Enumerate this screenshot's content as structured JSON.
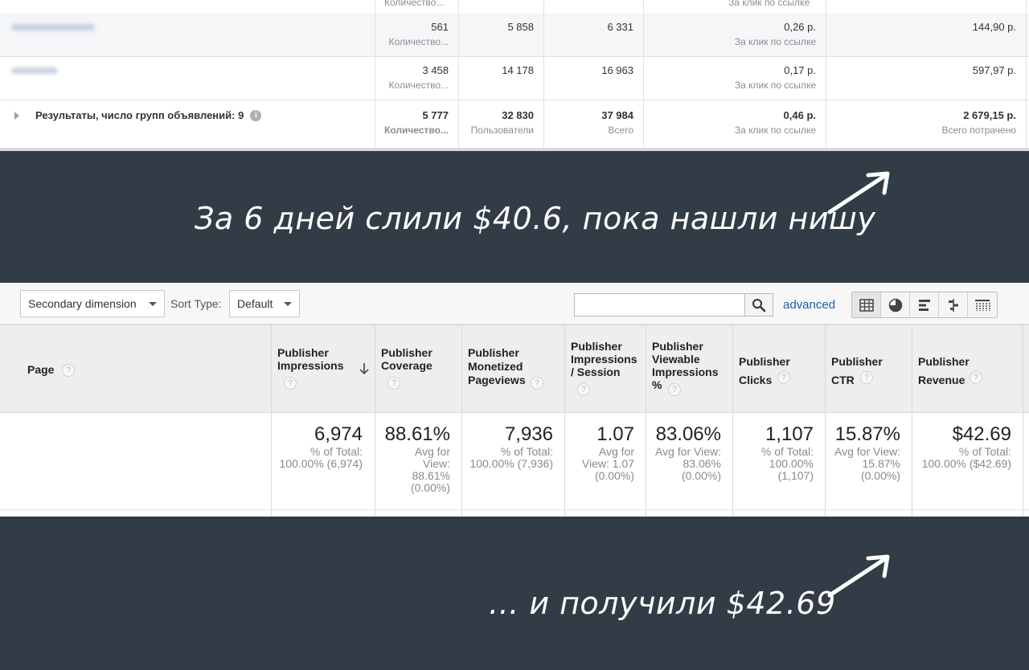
{
  "fb_table": {
    "top_row": {
      "sub": "Количество...",
      "sub_cpc": "За клик по ссылке"
    },
    "rows": [
      {
        "name": "██████ ████",
        "results": "561",
        "results_sub": "Количество...",
        "reach": "5 858",
        "impressions": "6 331",
        "cpc": "0,26 р.",
        "cpc_sub": "За клик по ссылке",
        "spent": "144,90 р."
      },
      {
        "name": "████",
        "results": "3 458",
        "results_sub": "Количество...",
        "reach": "14 178",
        "impressions": "16 963",
        "cpc": "0,17 р.",
        "cpc_sub": "За клик по ссылке",
        "spent": "597,97 р."
      }
    ],
    "totals": {
      "label": "Результаты, число групп объявлений: 9",
      "info_icon": "i",
      "results": "5 777",
      "results_sub": "Количество...",
      "reach": "32 830",
      "reach_sub": "Пользователи",
      "impressions": "37 984",
      "impressions_sub": "Всего",
      "cpc": "0,46 р.",
      "cpc_sub": "За клик по ссылке",
      "spent": "2 679,15 р.",
      "spent_sub": "Всего потрачено"
    }
  },
  "banner_top": {
    "caption": "За 6 дней слили $40.6, пока нашли нишу",
    "icon": "arrow-up-right-icon"
  },
  "banner_bottom": {
    "caption": "... и получили $42.69",
    "icon": "arrow-up-right-icon"
  },
  "ga": {
    "toolbar": {
      "secondary_dimension": "Secondary dimension",
      "sort_type_label": "Sort Type:",
      "sort_type_value": "Default",
      "search_value": "",
      "advanced_label": "advanced"
    },
    "columns": [
      {
        "title": "Page"
      },
      {
        "title": "Publisher Impressions",
        "value": "6,974",
        "sub": "% of Total: 100.00% (6,974)"
      },
      {
        "title": "Publisher Coverage",
        "value": "88.61%",
        "sub": "Avg for View: 88.61% (0.00%)"
      },
      {
        "title": "Publisher Monetized Pageviews",
        "value": "7,936",
        "sub": "% of Total: 100.00% (7,936)"
      },
      {
        "title": "Publisher Impressions / Session",
        "value": "1.07",
        "sub": "Avg for View: 1.07 (0.00%)"
      },
      {
        "title": "Publisher Viewable Impressions %",
        "value": "83.06%",
        "sub": "Avg for View: 83.06% (0.00%)"
      },
      {
        "title": "Publisher Clicks",
        "value": "1,107",
        "sub": "% of Total: 100.00% (1,107)"
      },
      {
        "title": "Publisher CTR",
        "value": "15.87%",
        "sub": "Avg for View: 15.87% (0.00%)"
      },
      {
        "title": "Publisher Revenue",
        "value": "$42.69",
        "sub": "% of Total: 100.00% ($42.69)"
      }
    ],
    "help_icon": "?",
    "sort_icon": "arrow-down-icon"
  },
  "colors": {
    "banner": "#323c46",
    "link": "#1a5fa6"
  }
}
